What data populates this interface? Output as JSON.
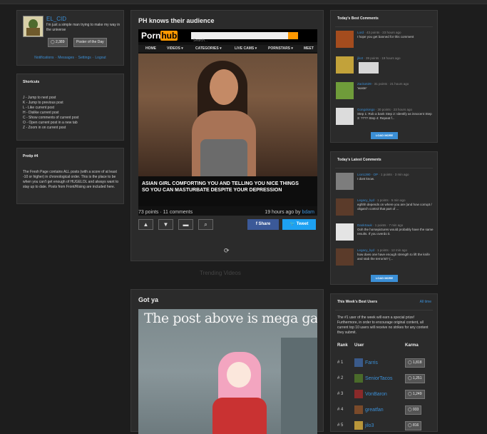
{
  "profile": {
    "username": "EL_CID",
    "bio": "I'm just a simple man trying to make my way in the universe",
    "badge_points": "◯ 2,389",
    "badge_title": "Poster of the Day",
    "links": [
      "Notifications",
      "Messages",
      "Settings",
      "Logout"
    ]
  },
  "shortcuts": {
    "title": "Shortcuts",
    "items": [
      "J - Jump to next post",
      "K - Jump to previous post",
      "L - Like current post",
      "H - Dislike current post",
      "C - Show comments of current post",
      "O - Open current post in a new tab",
      "Z - Zoom in on current post"
    ]
  },
  "protip": {
    "title": "Protip #4",
    "text": "The Fresh Page contains ALL posts (with a score of at least -10 or higher) in chronological order. This is the place to be when you can't get enough of HUGELOL and always want to stay up to date. Posts from Front/Rising are included here."
  },
  "post1": {
    "title": "PH knows their audience",
    "image": {
      "logo_text": "Porn",
      "logo_hub": "hub",
      "search_placeholder": "Search...",
      "nav": [
        "HOME",
        "VIDEOS ▾",
        "CATEGORIES ▾",
        "LIVE CAMS ▾",
        "PORNSTARS ▾",
        "MEET"
      ],
      "caption": "ASIAN GIRL COMFORTING YOU AND TELLING YOU NICE THINGS SO YOU CAN MASTURBATE DESPITE YOUR DEPRESSION"
    },
    "meta_left": "73 points · 11 comments",
    "meta_time": "19 hours ago by ",
    "meta_author": "bdam",
    "buttons": {
      "up": "▲",
      "down": "▼",
      "comment": "▬",
      "zoom": "⌕"
    },
    "share_label": "f  Share",
    "tweet_label": "🐦 Tweet",
    "loader": "⟳"
  },
  "trending_label": "Trending Videos",
  "post2": {
    "title": "Got ya",
    "meme_text": "The post above is mega gay"
  },
  "best_comments": {
    "title": "Today's Best Comments",
    "items": [
      {
        "user": "Lord",
        "meta": " · 43 points · 23 hours ago",
        "text": "I hope you get banned for this comment"
      },
      {
        "user": "jilo3",
        "meta": " · 39 points · 19 hours ago",
        "text": ""
      },
      {
        "user": "Zacko639",
        "meta": " · 31 points · 21 hours ago",
        "text": "'waste'"
      },
      {
        "user": "Gongolongo",
        "meta": " · 30 points · 23 hours ago",
        "text": "Step 1: Rob a bank Step 2: Identify as innocent Step 3: ???? Step 4: Repeat f..."
      }
    ],
    "load_more": "LOAD MORE"
  },
  "latest_comments": {
    "title": "Today's Latest Comments",
    "items": [
      {
        "user": "Lion1390 · OP",
        "meta": " · 1 points · 3 min ago",
        "text": "I dont know."
      },
      {
        "user": "Legacy_kyd",
        "meta": " · 1 points · 5 min ago",
        "text": "eghhh depends on where you are (and how corrupt / oligarch control that part of ..."
      },
      {
        "user": "DankSauk",
        "meta": " · 1 points · 7 min ago",
        "text": "Ooh the horsepictures would probably have the same results. If you overdo it."
      },
      {
        "user": "Legacy_kyd",
        "meta": " · 1 points · 12 min ago",
        "text": "how does one have enough strength to lift the knife and stab the terrorist? (..."
      }
    ],
    "load_more": "LOAD MORE"
  },
  "best_users": {
    "title": "This Week's Best Users",
    "all_time": "All time",
    "intro": "The #1 user of the week will earn a special prize! Furthermore, in order to encourage original content, all current top 10 users will receive no strikes for any content they submit.",
    "headers": {
      "rank": "Rank",
      "user": "User",
      "karma": "Karma"
    },
    "rows": [
      {
        "rank": "# 1",
        "name": "Farris",
        "karma": "◯ 1,818"
      },
      {
        "rank": "# 2",
        "name": "SeniorTacos",
        "karma": "◯ 1,251"
      },
      {
        "rank": "# 3",
        "name": "VonBaron",
        "karma": "◯ 1,249"
      },
      {
        "rank": "# 4",
        "name": "greatfan",
        "karma": "◯ 933"
      },
      {
        "rank": "# 5",
        "name": "jilo3",
        "karma": "◯ 816"
      }
    ]
  },
  "colors": {
    "accent": "#3b8fd6",
    "facebook": "#3b5998",
    "twitter": "#1da1f2",
    "pornhub_orange": "#ff9900"
  }
}
